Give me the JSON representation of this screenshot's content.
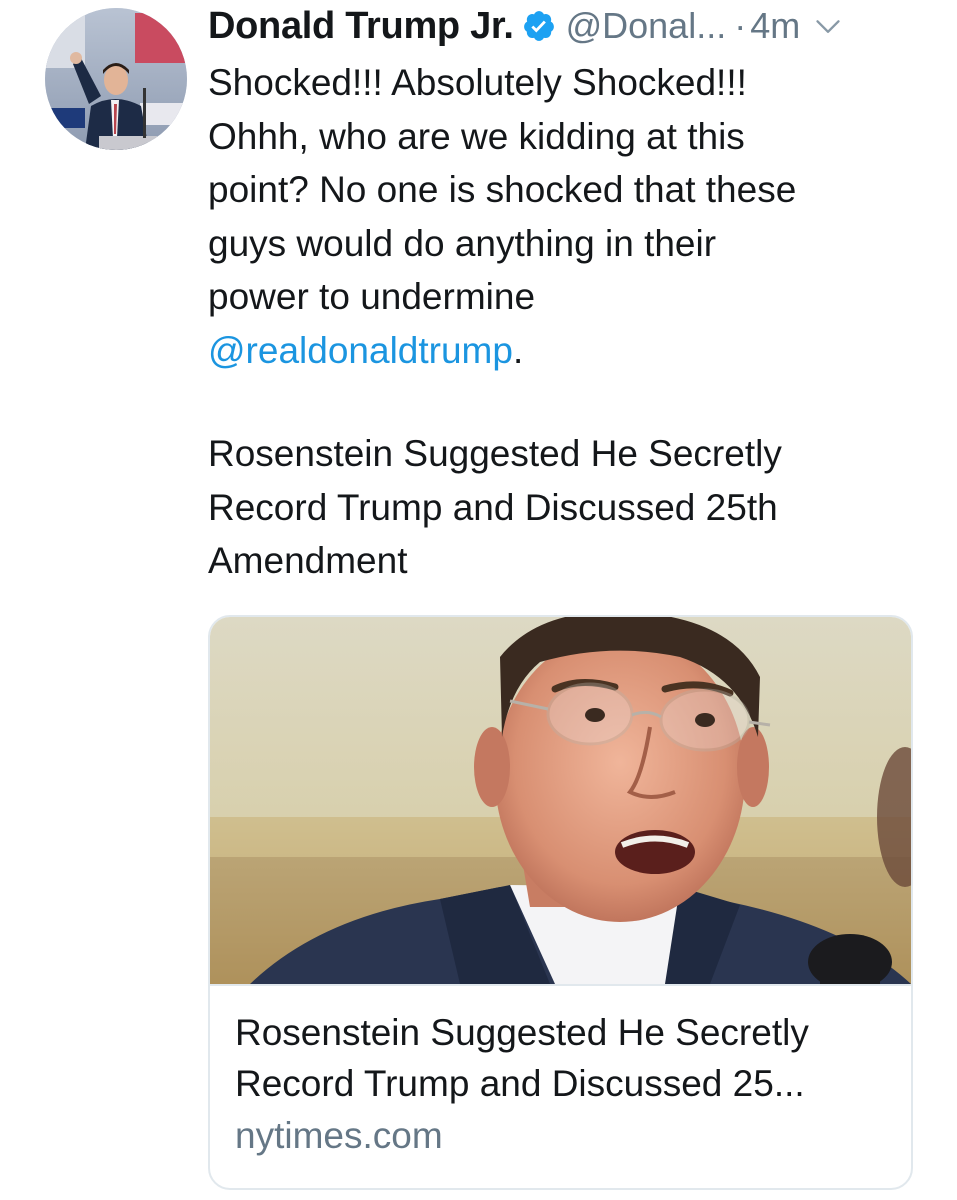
{
  "author": {
    "display_name": "Donald Trump Jr.",
    "handle": "@Donal...",
    "separator": "·",
    "time": "4m",
    "verified_icon": "verified-badge-icon",
    "avatar_icon": "avatar-photo"
  },
  "tweet": {
    "lines": [
      "Shocked!!! Absolutely Shocked!!!",
      "Ohhh, who are we kidding at this",
      "point? No one is shocked that these",
      "guys would do anything in their",
      "power to undermine"
    ],
    "mention": "@realdonaldtrump",
    "mention_suffix": ".",
    "headline_lines": [
      "Rosenstein Suggested He Secretly",
      "Record Trump and Discussed 25th",
      "Amendment"
    ]
  },
  "card": {
    "title_lines": [
      "Rosenstein Suggested He Secretly",
      "Record Trump and Discussed 25..."
    ],
    "domain": "nytimes.com",
    "image_icon": "article-photo"
  },
  "colors": {
    "link": "#1b95e0",
    "secondary": "#657786",
    "border": "#e1e8ed",
    "verified": "#1da1f2"
  }
}
